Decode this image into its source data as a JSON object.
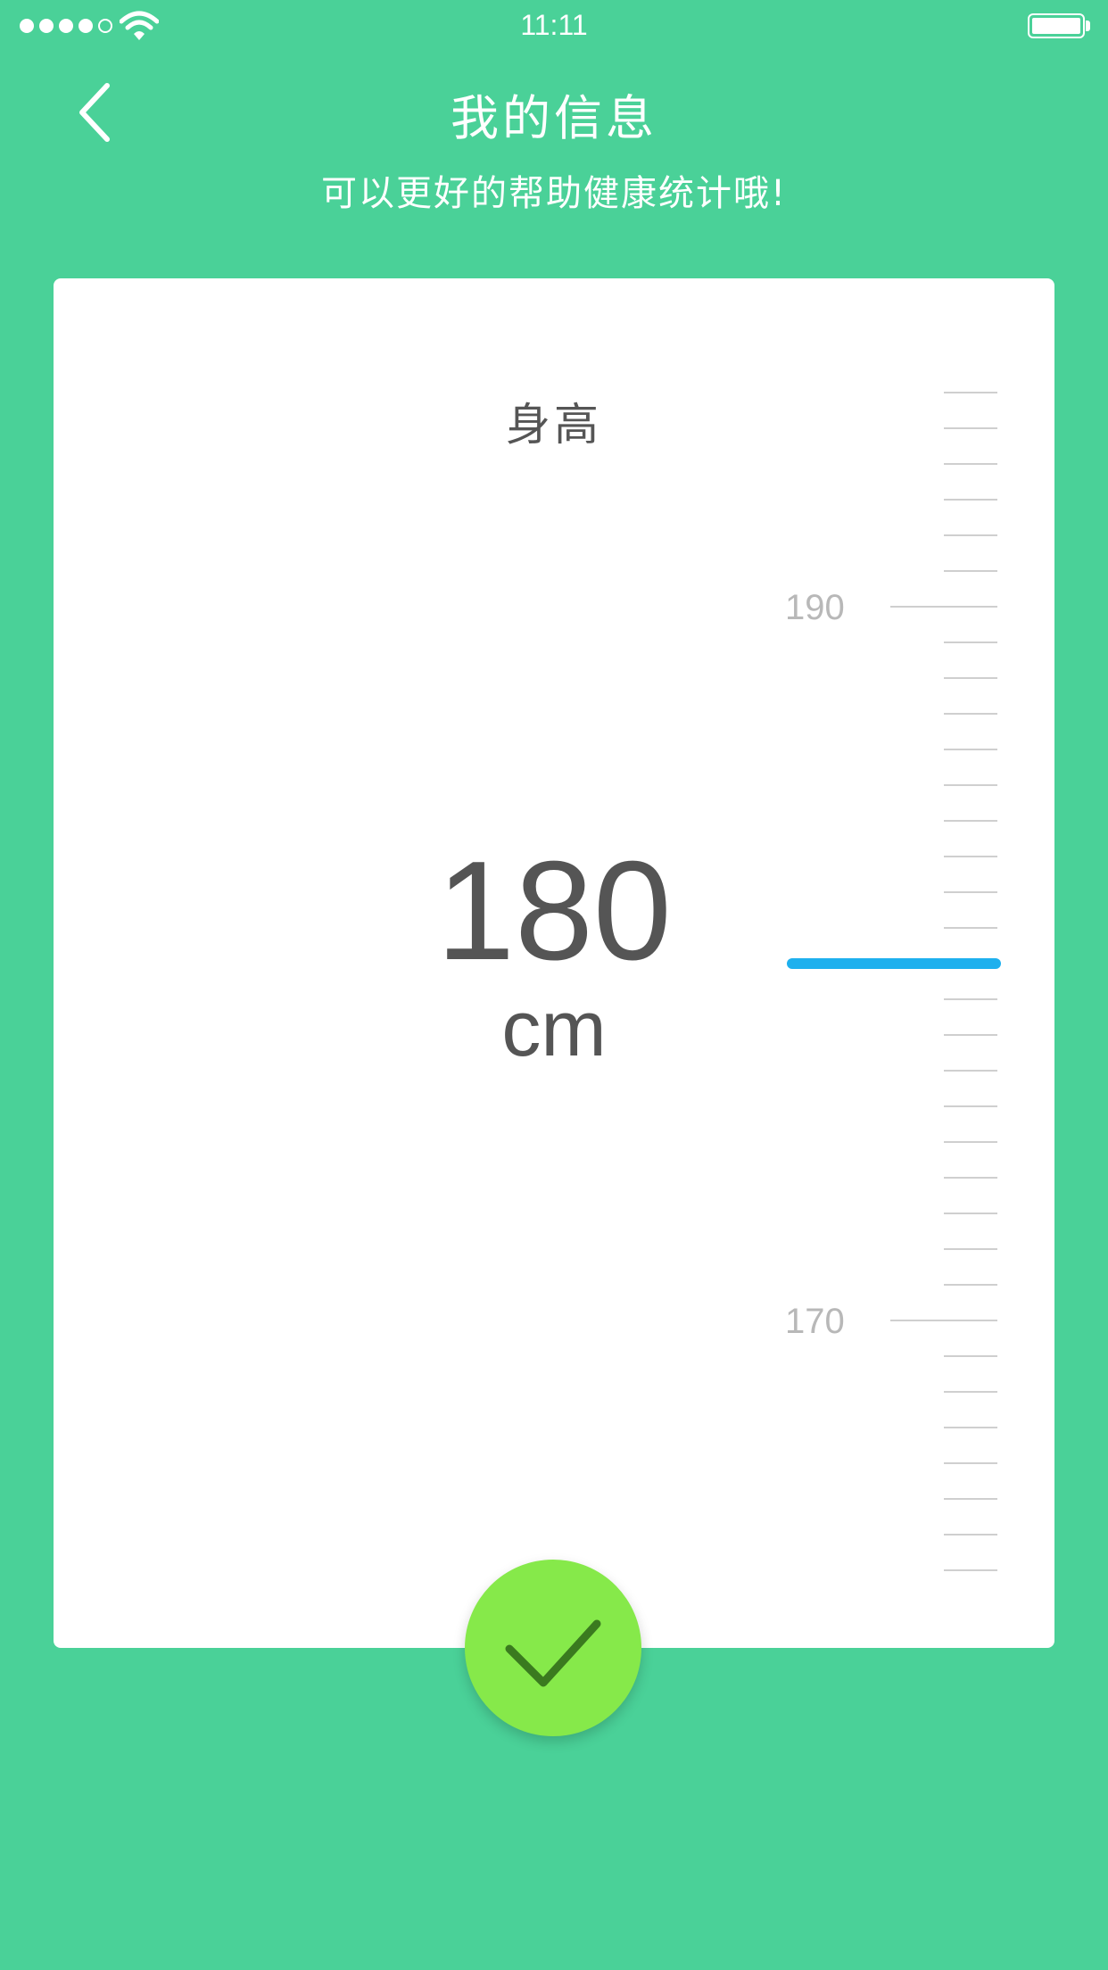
{
  "status_bar": {
    "time": "11:11",
    "signal_filled": 4,
    "signal_total": 5,
    "battery_level": 1.0
  },
  "header": {
    "back_icon": "chevron-left-icon",
    "title": "我的信息",
    "subtitle": "可以更好的帮助健康统计哦!"
  },
  "card": {
    "label": "身高",
    "value": "180",
    "unit": "cm"
  },
  "ruler": {
    "selected_value": 180,
    "labels": [
      {
        "value": 190,
        "text": "190"
      },
      {
        "value": 170,
        "text": "170"
      }
    ]
  },
  "confirm": {
    "icon": "checkmark-icon"
  },
  "colors": {
    "background": "#4ad198",
    "card": "#ffffff",
    "indicator": "#1eb0ee",
    "confirm": "#86e94a",
    "check": "#3a7a1f",
    "text": "#555555",
    "tick": "#cfcfcf"
  }
}
